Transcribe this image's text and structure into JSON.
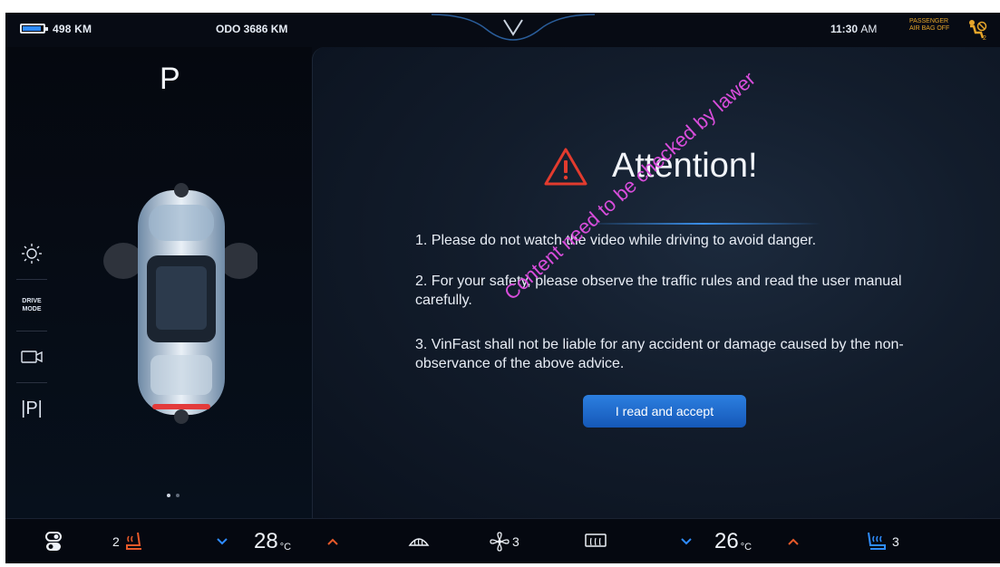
{
  "status_bar": {
    "range": "498 KM",
    "odometer": "ODO 3686 KM",
    "time": "11:30",
    "time_suffix": "AM",
    "airbag_line1": "PASSENGER",
    "airbag_line2": "AIR BAG OFF"
  },
  "left_panel": {
    "gear": "P",
    "side_items": [
      {
        "name": "light-icon",
        "glyph": "☼"
      },
      {
        "name": "drive-mode",
        "label": "DRIVE\nMODE"
      },
      {
        "name": "camera-icon",
        "glyph": "camera"
      },
      {
        "name": "park-assist-icon",
        "glyph": "|P|"
      }
    ],
    "drive_mode_label_1": "DRIVE",
    "drive_mode_label_2": "MODE",
    "park_label": "|P|"
  },
  "dialog": {
    "title": "Attention!",
    "notices": [
      "1. Please do not watch the video while driving to avoid danger.",
      "2. For your safety, please observe the traffic rules and read the user manual carefully.",
      "3. VinFast shall not be liable for any accident or damage caused by the non-observance of the above advice."
    ],
    "accept_label": "I read and accept",
    "watermark": "Content need to be checked by lawer"
  },
  "climate": {
    "driver_seat_heat_level": "2",
    "driver_temp": "28",
    "temp_unit": "°C",
    "fan_level": "3",
    "passenger_temp": "26",
    "passenger_seat_level": "3"
  },
  "colors": {
    "accent_blue": "#2f8cff",
    "warning_red": "#e23b2e",
    "heat_orange": "#e85a2a",
    "watermark_magenta": "#d84ddb",
    "airbag_amber": "#e6a52a"
  }
}
